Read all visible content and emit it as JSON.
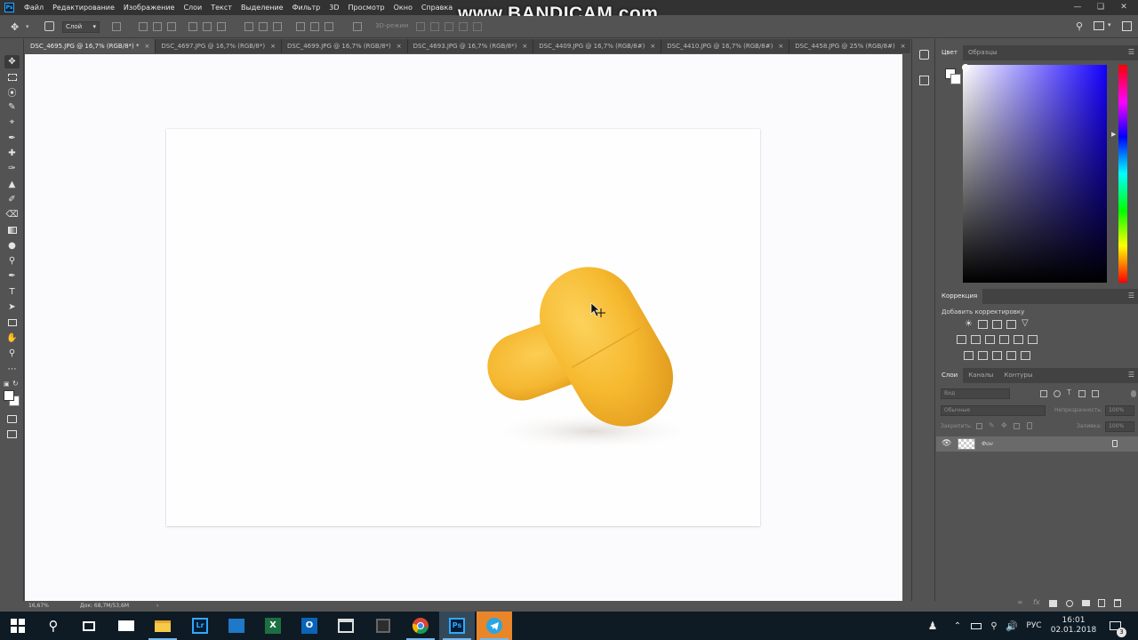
{
  "app": {
    "menu": [
      "Файл",
      "Редактирование",
      "Изображение",
      "Слои",
      "Текст",
      "Выделение",
      "Фильтр",
      "3D",
      "Просмотр",
      "Окно",
      "Справка"
    ],
    "watermark": "www.BANDICAM.com"
  },
  "options": {
    "auto_select_value": "Слой",
    "mode_3d_label": "3D-режим"
  },
  "tabs": [
    {
      "label": "DSC_4695.JPG @ 16,7% (RGB/8*) *",
      "active": true
    },
    {
      "label": "DSC_4697.JPG @ 16,7% (RGB/8*)"
    },
    {
      "label": "DSC_4699.JPG @ 16,7% (RGB/8*)"
    },
    {
      "label": "DSC_4693.JPG @ 16,7% (RGB/8*)"
    },
    {
      "label": "DSC_4409.JPG @ 16,7% (RGB/8#)"
    },
    {
      "label": "DSC_4410.JPG @ 16,7% (RGB/8#)"
    },
    {
      "label": "DSC_4458.JPG @ 25% (RGB/8#)"
    }
  ],
  "tab_close": "×",
  "status": {
    "zoom": "16,67%",
    "doc": "Док: 68,7M/53,6M",
    "arrow": "›"
  },
  "color_panel": {
    "tabs": [
      "Цвет",
      "Образцы"
    ],
    "hue_color": "#1500ff"
  },
  "adjustments_panel": {
    "title": "Коррекция",
    "subtitle": "Добавить корректировку"
  },
  "layers_panel": {
    "tabs": [
      "Слои",
      "Каналы",
      "Контуры"
    ],
    "search_placeholder": "Вид",
    "blend_mode": "Обычные",
    "opacity_label": "Непрозрачность:",
    "opacity_value": "100%",
    "lock_label": "Закрепить:",
    "fill_label": "Заливка:",
    "fill_value": "100%",
    "layers": [
      {
        "name": "Фон",
        "visible": true,
        "locked": true
      }
    ]
  },
  "taskbar": {
    "apps": [
      "start-icon",
      "search-icon",
      "task-view-icon",
      "mail-icon",
      "file-explorer-icon",
      "lightroom-icon",
      "store-icon",
      "excel-icon",
      "outlook-icon",
      "film-icon",
      "blank-app-icon",
      "chrome-icon",
      "photoshop-icon",
      "telegram-icon"
    ],
    "lr_label": "Lr",
    "x_label": "X",
    "o_label": "O",
    "ps_label": "Ps",
    "time": "16:01",
    "date": "02.01.2018",
    "language": "РУС",
    "notification_count": "3"
  },
  "colors": {
    "accent": "#31a8ff",
    "pill": "#f5b731"
  }
}
